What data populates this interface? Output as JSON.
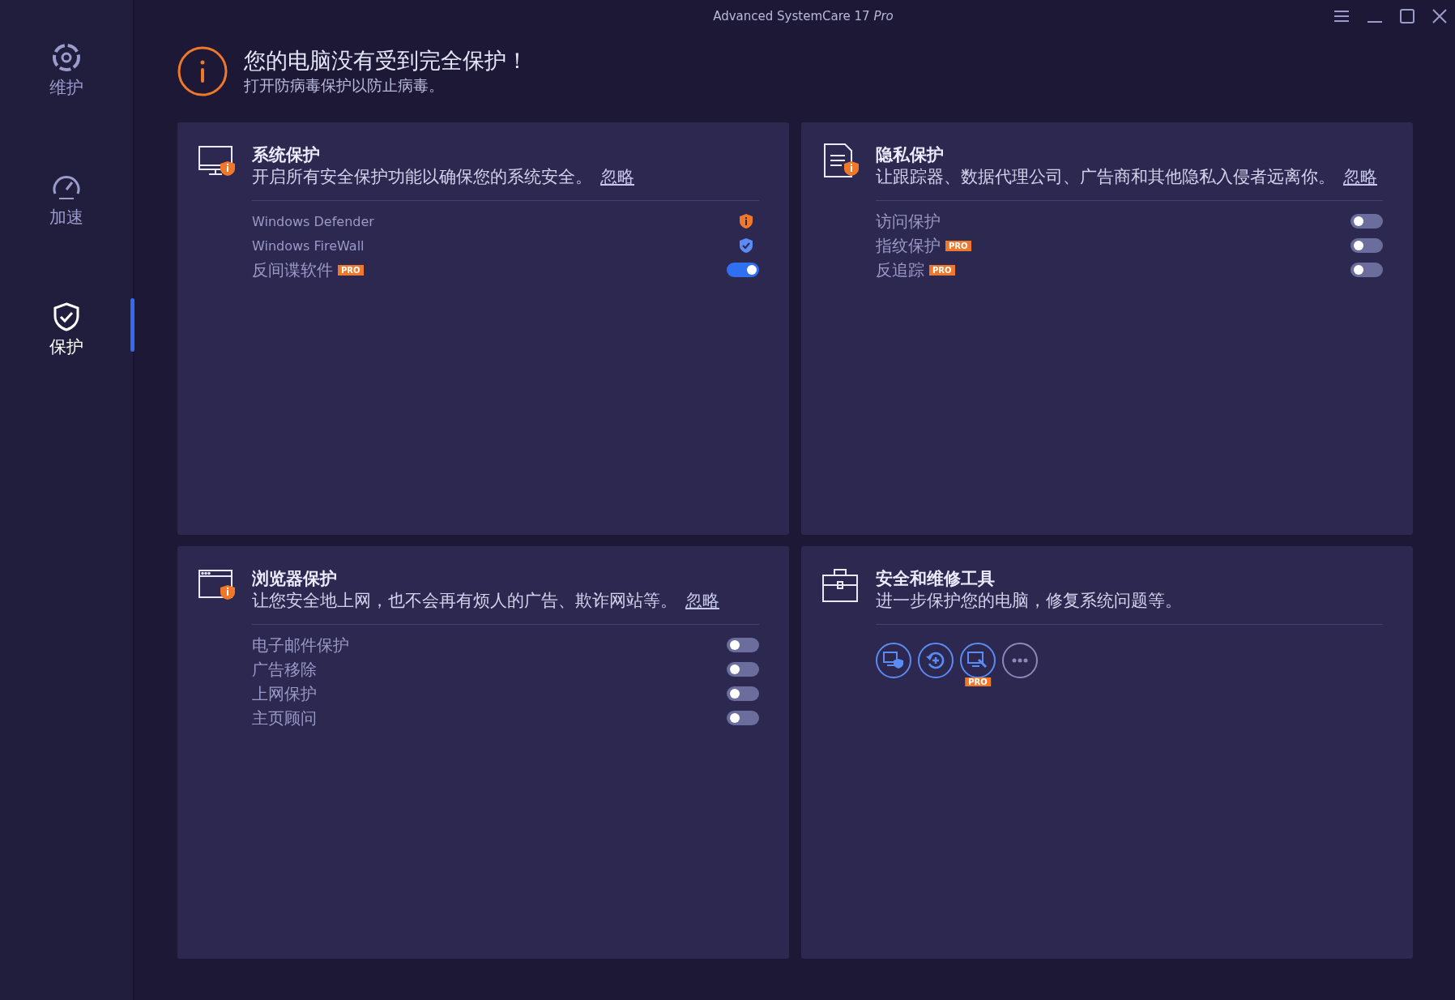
{
  "window": {
    "title": "Advanced SystemCare 17 *Pro*"
  },
  "sidebar": {
    "items": [
      {
        "kind": "maintain",
        "label": "维护",
        "selected": false
      },
      {
        "kind": "speed",
        "label": "加速",
        "selected": false
      },
      {
        "kind": "protect",
        "label": "保护",
        "selected": true
      }
    ]
  },
  "alert": {
    "title": "您的电脑没有受到完全保护！",
    "subtitle": "打开防病毒保护以防止病毒。"
  },
  "cards": [
    {
      "kind": "monitor",
      "warning": true,
      "title": "系统保护",
      "description": "开启所有安全保护功能以确保您的系统安全。",
      "link": "忽略",
      "rows": [
        {
          "kind": "status",
          "label": "Windows Defender",
          "ok": false
        },
        {
          "kind": "status",
          "label": "Windows FireWall",
          "ok": true
        },
        {
          "kind": "toggle",
          "label": "反间谍软件",
          "badge": "PRO",
          "on": true
        }
      ]
    },
    {
      "kind": "document",
      "warning": true,
      "title": "隐私保护",
      "description": "让跟踪器、数据代理公司、广告商和其他隐私入侵者远离你。",
      "link": "忽略",
      "rows": [
        {
          "kind": "toggle",
          "label": "访问保护",
          "on": false
        },
        {
          "kind": "toggle",
          "label": "指纹保护",
          "badge": "PRO",
          "on": false
        },
        {
          "kind": "toggle",
          "label": "反追踪",
          "badge": "PRO",
          "on": false
        }
      ]
    },
    {
      "kind": "browser",
      "warning": true,
      "title": "浏览器保护",
      "description": "让您安全地上网，也不会再有烦人的广告、欺诈网站等。",
      "link": "忽略",
      "rows": [
        {
          "kind": "toggle",
          "label": "电子邮件保护",
          "on": false
        },
        {
          "kind": "toggle",
          "label": "广告移除",
          "on": false
        },
        {
          "kind": "toggle",
          "label": "上网保护",
          "on": false
        },
        {
          "kind": "toggle",
          "label": "主页顾问",
          "on": false
        }
      ]
    },
    {
      "kind": "toolbox",
      "warning": false,
      "title": "安全和维修工具",
      "description": "进一步保护您的电脑，修复系统问题等。",
      "tools": [
        {
          "kind": "guard"
        },
        {
          "kind": "rescue"
        },
        {
          "kind": "repair",
          "badge": "PRO"
        },
        {
          "kind": "more"
        }
      ]
    }
  ]
}
